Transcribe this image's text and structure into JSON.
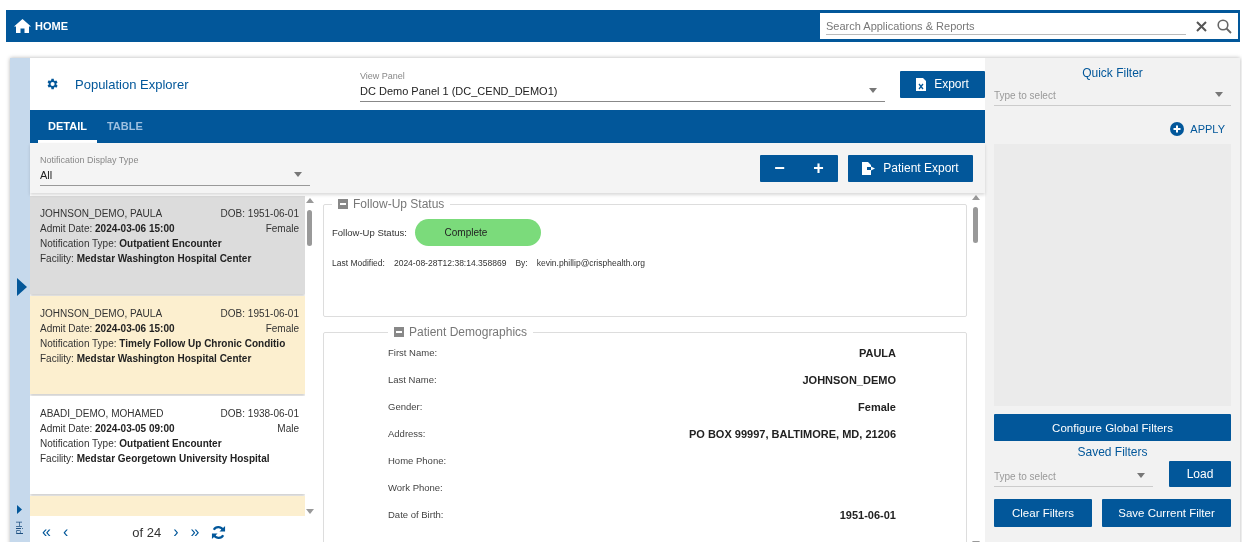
{
  "top_bar": {
    "home": "HOME",
    "search": {
      "placeholder": "Search Applications & Reports"
    }
  },
  "header": {
    "title": "Population Explorer",
    "view_panel": {
      "label": "View Panel",
      "value": "DC Demo Panel 1 (DC_CEND_DEMO1)"
    },
    "export": "Export"
  },
  "tabs": [
    {
      "label": "DETAIL",
      "selected": true
    },
    {
      "label": "TABLE",
      "selected": false
    }
  ],
  "notification_type": {
    "label": "Notification Display Type",
    "value": "All"
  },
  "toolbar": {
    "zoom_out": "−",
    "zoom_in": "+",
    "patient_export": "Patient Export"
  },
  "side_strip": {
    "label": "Hid"
  },
  "notifications": [
    {
      "name": "JOHNSON_DEMO, PAULA",
      "dob": "DOB: 1951-06-01",
      "admit_label": "Admit Date:",
      "admit": "2024-03-06 15:00",
      "gender": "Female",
      "type_label": "Notification Type:",
      "type": "Outpatient Encounter",
      "facility_label": "Facility:",
      "facility": "Medstar Washington Hospital Center",
      "selected": true
    },
    {
      "name": "JOHNSON_DEMO, PAULA",
      "dob": "DOB: 1951-06-01",
      "admit_label": "Admit Date:",
      "admit": "2024-03-06 15:00",
      "gender": "Female",
      "type_label": "Notification Type:",
      "type": "Timely Follow Up Chronic Conditio",
      "facility_label": "Facility:",
      "facility": "Medstar Washington Hospital Center",
      "selected": false,
      "highlighted": true
    },
    {
      "name": "ABADI_DEMO, MOHAMED",
      "dob": "DOB: 1938-06-01",
      "admit_label": "Admit Date:",
      "admit": "2024-03-05 09:00",
      "gender": "Male",
      "type_label": "Notification Type:",
      "type": "Outpatient Encounter",
      "facility_label": "Facility:",
      "facility": "Medstar Georgetown University Hospital",
      "selected": false,
      "highlighted": false
    },
    {
      "selected": false,
      "highlighted": true
    }
  ],
  "pager": {
    "first": "«",
    "prev": "‹",
    "of": "of 24",
    "next": "›",
    "last": "»"
  },
  "follow_up": {
    "title": "Follow-Up Status",
    "status_label": "Follow-Up Status:",
    "status": "Complete",
    "modified_label": "Last Modified:",
    "modified": "2024-08-28T12:38:14.358869",
    "by_label": "By:",
    "by": "kevin.phillip@crisphealth.org"
  },
  "demographics": {
    "title": "Patient Demographics",
    "rows": [
      {
        "label": "First Name:",
        "value": "PAULA"
      },
      {
        "label": "Last Name:",
        "value": "JOHNSON_DEMO"
      },
      {
        "label": "Gender:",
        "value": "Female"
      },
      {
        "label": "Address:",
        "value": "PO BOX 99997, BALTIMORE, MD, 21206"
      },
      {
        "label": "Home Phone:"
      },
      {
        "label": "Work Phone:"
      },
      {
        "label": "Date of Birth:",
        "value": "1951-06-01"
      }
    ]
  },
  "quick_filter": {
    "title": "Quick Filter",
    "placeholder": "Type to select",
    "apply": "APPLY"
  },
  "configure": "Configure Global Filters",
  "saved_filters": {
    "title": "Saved Filters",
    "placeholder": "Type to select",
    "load": "Load"
  },
  "clear": "Clear Filters",
  "save": "Save Current Filter"
}
